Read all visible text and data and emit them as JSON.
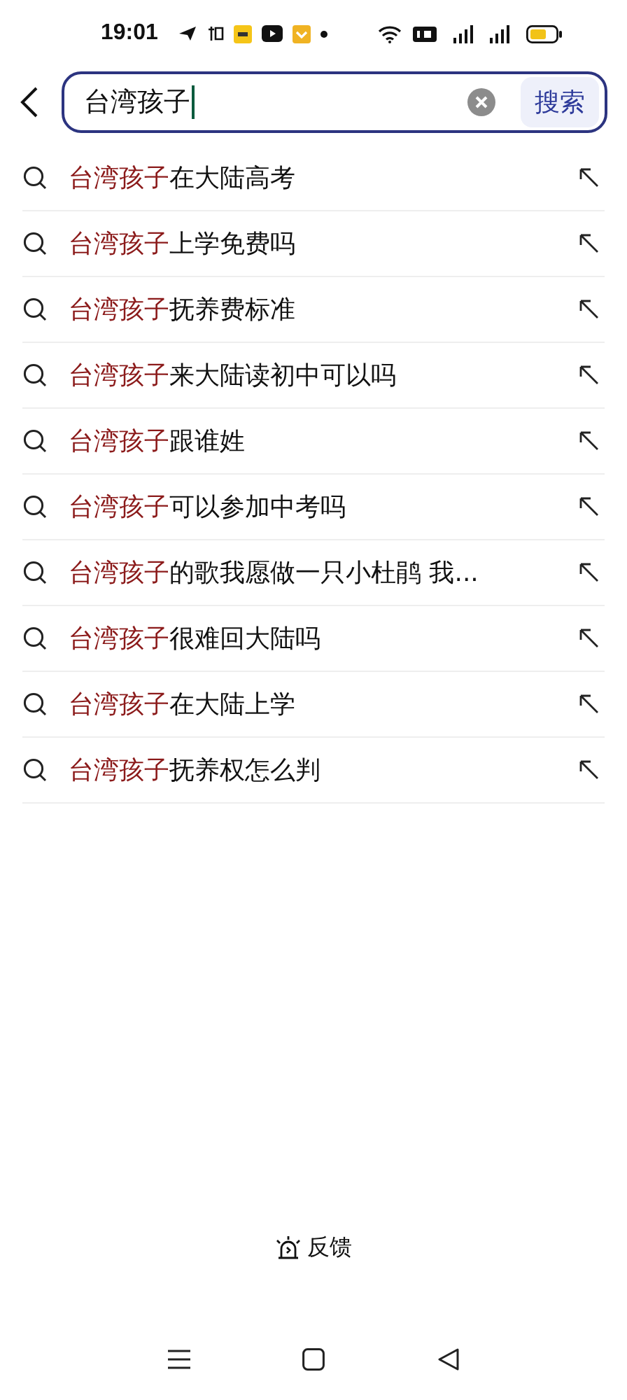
{
  "status_bar": {
    "time": "19:01"
  },
  "search": {
    "value": "台湾孩子",
    "button": "搜索"
  },
  "suggestions": [
    {
      "match": "台湾孩子",
      "rest": "在大陆高考"
    },
    {
      "match": "台湾孩子",
      "rest": "上学免费吗"
    },
    {
      "match": "台湾孩子",
      "rest": "抚养费标准"
    },
    {
      "match": "台湾孩子",
      "rest": "来大陆读初中可以吗"
    },
    {
      "match": "台湾孩子",
      "rest": "跟谁姓"
    },
    {
      "match": "台湾孩子",
      "rest": "可以参加中考吗"
    },
    {
      "match": "台湾孩子",
      "rest": "的歌我愿做一只小杜鹃 我..."
    },
    {
      "match": "台湾孩子",
      "rest": "很难回大陆吗"
    },
    {
      "match": "台湾孩子",
      "rest": "在大陆上学"
    },
    {
      "match": "台湾孩子",
      "rest": "抚养权怎么判"
    }
  ],
  "feedback": "反馈"
}
